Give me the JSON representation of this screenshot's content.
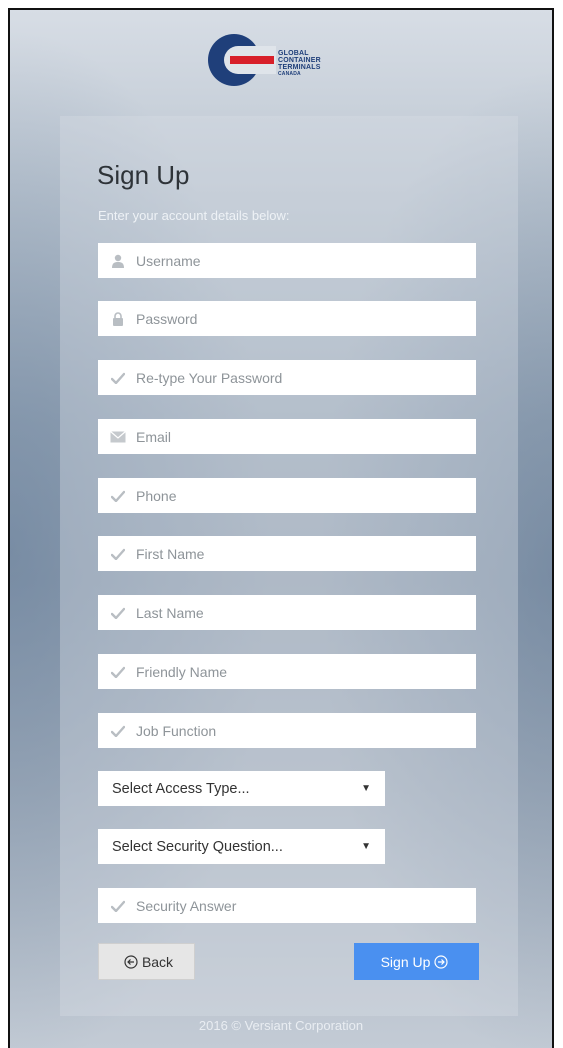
{
  "logo": {
    "lines": [
      "GLOBAL",
      "CONTAINER",
      "TERMINALS"
    ],
    "subline": "CANADA",
    "colors": {
      "blue": "#1f3f7a",
      "red": "#d8202a"
    }
  },
  "form": {
    "title": "Sign Up",
    "subtitle": "Enter your account details below:",
    "fields": [
      {
        "placeholder": "Username",
        "icon": "user-icon"
      },
      {
        "placeholder": "Password",
        "icon": "lock-icon"
      },
      {
        "placeholder": "Re-type Your Password",
        "icon": "check-icon"
      },
      {
        "placeholder": "Email",
        "icon": "envelope-icon"
      },
      {
        "placeholder": "Phone",
        "icon": "check-icon"
      },
      {
        "placeholder": "First Name",
        "icon": "check-icon"
      },
      {
        "placeholder": "Last Name",
        "icon": "check-icon"
      },
      {
        "placeholder": "Friendly Name",
        "icon": "check-icon"
      },
      {
        "placeholder": "Job Function",
        "icon": "check-icon"
      }
    ],
    "access_type": {
      "selected": "Select Access Type..."
    },
    "security_question": {
      "selected": "Select Security Question..."
    },
    "security_answer": {
      "placeholder": "Security Answer",
      "icon": "check-icon"
    },
    "back_label": "Back",
    "signup_label": "Sign Up",
    "accent_color": "#4a90f0"
  },
  "footer": {
    "text": "2016 © Versiant Corporation"
  }
}
